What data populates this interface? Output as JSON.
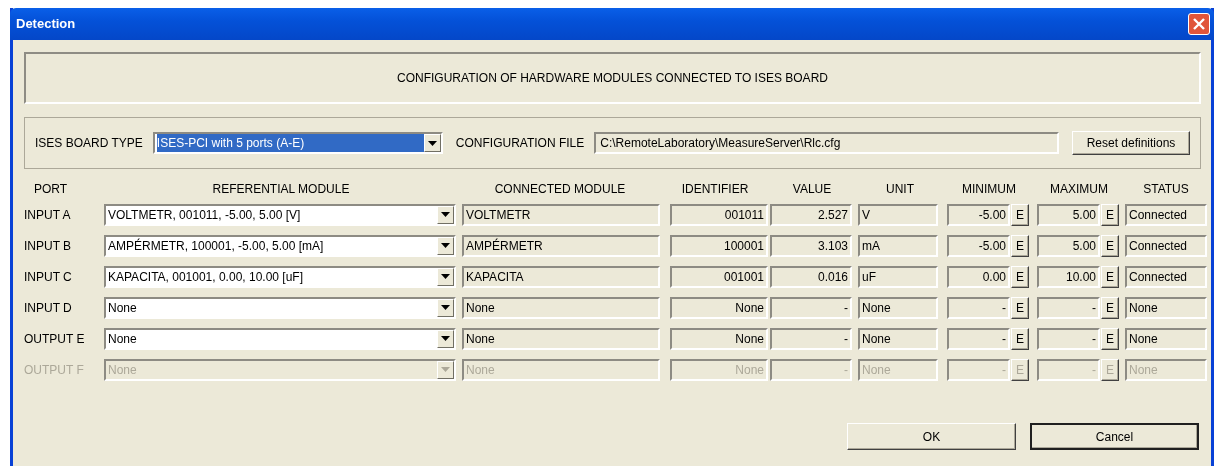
{
  "window": {
    "title": "Detection"
  },
  "heading": "CONFIGURATION OF HARDWARE MODULES CONNECTED TO ISES BOARD",
  "board": {
    "label": "ISES BOARD TYPE",
    "value": "ISES-PCI with 5 ports (A-E)",
    "text_selected": true,
    "config_label": "CONFIGURATION FILE",
    "config_value": "C:\\RemoteLaboratory\\MeasureServer\\Rlc.cfg",
    "reset_button": "Reset definitions"
  },
  "columns": [
    "PORT",
    "REFERENTIAL MODULE",
    "CONNECTED MODULE",
    "IDENTIFIER",
    "VALUE",
    "UNIT",
    "MINIMUM",
    "MAXIMUM",
    "STATUS"
  ],
  "rows": [
    {
      "port": "INPUT A",
      "referential": "VOLTMETR, 001011, -5.00, 5.00 [V]",
      "connected": "VOLTMETR",
      "identifier": "001011",
      "value": "2.527",
      "unit": "V",
      "minimum": "-5.00",
      "min_edit": "E",
      "maximum": "5.00",
      "max_edit": "E",
      "status": "Connected",
      "disabled": false
    },
    {
      "port": "INPUT B",
      "referential": "AMPÉRMETR, 100001, -5.00, 5.00 [mA]",
      "connected": "AMPÉRMETR",
      "identifier": "100001",
      "value": "3.103",
      "unit": "mA",
      "minimum": "-5.00",
      "min_edit": "E",
      "maximum": "5.00",
      "max_edit": "E",
      "status": "Connected",
      "disabled": false
    },
    {
      "port": "INPUT C",
      "referential": "KAPACITA, 001001, 0.00, 10.00 [uF]",
      "connected": "KAPACITA",
      "identifier": "001001",
      "value": "0.016",
      "unit": "uF",
      "minimum": "0.00",
      "min_edit": "E",
      "maximum": "10.00",
      "max_edit": "E",
      "status": "Connected",
      "disabled": false
    },
    {
      "port": "INPUT D",
      "referential": "None",
      "connected": "None",
      "identifier": "None",
      "value": "-",
      "unit": "None",
      "minimum": "-",
      "min_edit": "E",
      "maximum": "-",
      "max_edit": "E",
      "status": "None",
      "disabled": false
    },
    {
      "port": "OUTPUT E",
      "referential": "None",
      "connected": "None",
      "identifier": "None",
      "value": "-",
      "unit": "None",
      "minimum": "-",
      "min_edit": "E",
      "maximum": "-",
      "max_edit": "E",
      "status": "None",
      "disabled": false
    },
    {
      "port": "OUTPUT F",
      "referential": "None",
      "connected": "None",
      "identifier": "None",
      "value": "-",
      "unit": "None",
      "minimum": "-",
      "min_edit": "E",
      "maximum": "-",
      "max_edit": "E",
      "status": "None",
      "disabled": true
    }
  ],
  "buttons": [
    {
      "label": "OK",
      "default": false
    },
    {
      "label": "Cancel",
      "default": true
    }
  ]
}
